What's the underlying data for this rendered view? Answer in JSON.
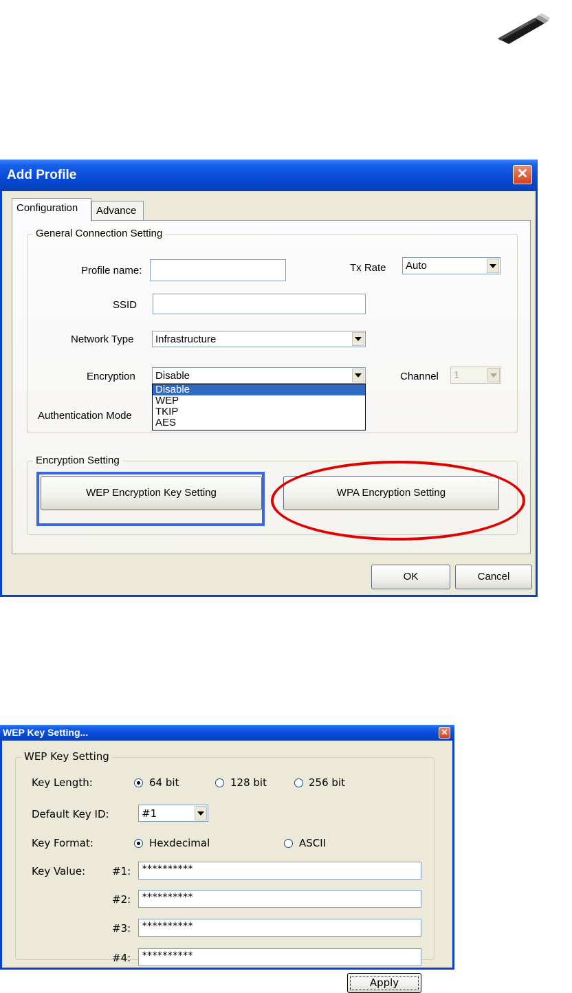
{
  "add_profile": {
    "title": "Add Profile",
    "close_glyph": "✕",
    "tabs": [
      "Configuration",
      "Advance"
    ],
    "general_group": "General Connection Setting",
    "profile_name_label": "Profile name:",
    "profile_name_value": "",
    "tx_rate_label": "Tx Rate",
    "tx_rate_value": "Auto",
    "ssid_label": "SSID",
    "ssid_value": "",
    "network_type_label": "Network Type",
    "network_type_value": "Infrastructure",
    "encryption_label": "Encryption",
    "encryption_value": "Disable",
    "encryption_options": [
      "Disable",
      "WEP",
      "TKIP",
      "AES"
    ],
    "channel_label": "Channel",
    "channel_value": "1",
    "auth_mode_label": "Authentication Mode",
    "encryption_group": "Encryption Setting",
    "wep_button": "WEP Encryption Key Setting",
    "wpa_button": "WPA Encryption Setting",
    "ok_button": "OK",
    "cancel_button": "Cancel"
  },
  "wep_dialog": {
    "title": "WEP Key Setting...",
    "close_glyph": "✕",
    "group": "WEP Key Setting",
    "key_length_label": "Key Length:",
    "key_length_options": [
      "64 bit",
      "128 bit",
      "256 bit"
    ],
    "key_length_selected": "64 bit",
    "default_key_label": "Default Key ID:",
    "default_key_value": "#1",
    "key_format_label": "Key Format:",
    "key_format_options": [
      "Hexdecimal",
      "ASCII"
    ],
    "key_format_selected": "Hexdecimal",
    "key_value_label": "Key Value:",
    "keys": [
      {
        "id": "#1:",
        "value": "**********"
      },
      {
        "id": "#2:",
        "value": "**********"
      },
      {
        "id": "#3:",
        "value": "**********"
      },
      {
        "id": "#4:",
        "value": "**********"
      }
    ],
    "apply_button": "Apply"
  },
  "colors": {
    "highlight_rect": "#3a66e0",
    "highlight_ellipse": "#e00000",
    "title_bar": "#0a4bd8",
    "dialog_bg": "#ece9d8"
  }
}
